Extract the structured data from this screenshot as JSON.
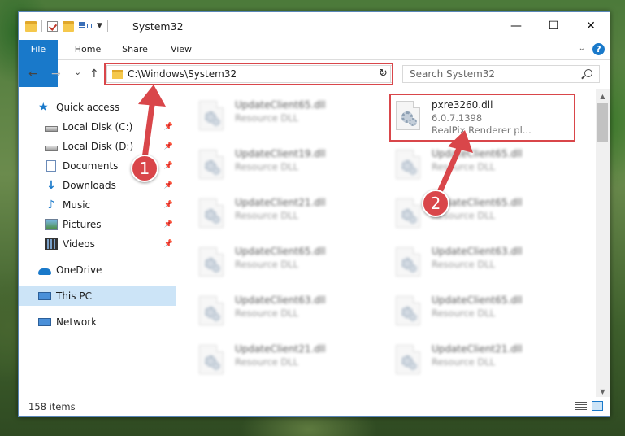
{
  "window": {
    "title": "System32",
    "controls": {
      "minimize": "—",
      "maximize": "☐",
      "close": "✕"
    }
  },
  "ribbon": {
    "tabs": [
      {
        "label": "File"
      },
      {
        "label": "Home"
      },
      {
        "label": "Share"
      },
      {
        "label": "View"
      }
    ],
    "help": "?"
  },
  "navbar": {
    "back": "←",
    "forward": "→",
    "recent": "⌄",
    "up": "↑",
    "address": "C:\\Windows\\System32",
    "refresh": "↻",
    "search_placeholder": "Search System32"
  },
  "sidebar": {
    "items": [
      {
        "label": "Quick access",
        "icon": "star-icon"
      },
      {
        "label": "Local Disk (C:)",
        "icon": "drive-icon",
        "pinned": true
      },
      {
        "label": "Local Disk (D:)",
        "icon": "drive-icon",
        "pinned": true
      },
      {
        "label": "Documents",
        "icon": "documents-icon",
        "pinned": true
      },
      {
        "label": "Downloads",
        "icon": "download-icon",
        "pinned": true
      },
      {
        "label": "Music",
        "icon": "music-icon",
        "pinned": true
      },
      {
        "label": "Pictures",
        "icon": "pictures-icon",
        "pinned": true
      },
      {
        "label": "Videos",
        "icon": "videos-icon",
        "pinned": true
      },
      {
        "label": "OneDrive",
        "icon": "cloud-icon"
      },
      {
        "label": "This PC",
        "icon": "computer-icon",
        "selected": true
      },
      {
        "label": "Network",
        "icon": "network-icon"
      }
    ]
  },
  "files": {
    "highlighted": {
      "name": "pxre3260.dll",
      "version": "6.0.7.1398",
      "description": "RealPix Renderer pl..."
    },
    "left_column": [
      {
        "name": "UpdateClient65.dll",
        "type": "Resource DLL"
      },
      {
        "name": "UpdateClient19.dll",
        "type": "Resource DLL"
      },
      {
        "name": "UpdateClient21.dll",
        "type": "Resource DLL"
      },
      {
        "name": "UpdateClient65.dll",
        "type": "Resource DLL"
      },
      {
        "name": "UpdateClient63.dll",
        "type": "Resource DLL"
      },
      {
        "name": "UpdateClient21.dll",
        "type": "Resource DLL"
      }
    ],
    "right_column": [
      {
        "name": "UpdateClient65.dll",
        "type": "Resource DLL"
      },
      {
        "name": "UpdateClient65.dll",
        "type": "Resource DLL"
      },
      {
        "name": "UpdateClient63.dll",
        "type": "Resource DLL"
      },
      {
        "name": "UpdateClient65.dll",
        "type": "Resource DLL"
      },
      {
        "name": "UpdateClient21.dll",
        "type": "Resource DLL"
      }
    ]
  },
  "status": {
    "item_count": "158 items"
  },
  "callouts": {
    "first": "1",
    "second": "2"
  },
  "colors": {
    "accent": "#1979ca",
    "highlight": "#d9464a"
  }
}
